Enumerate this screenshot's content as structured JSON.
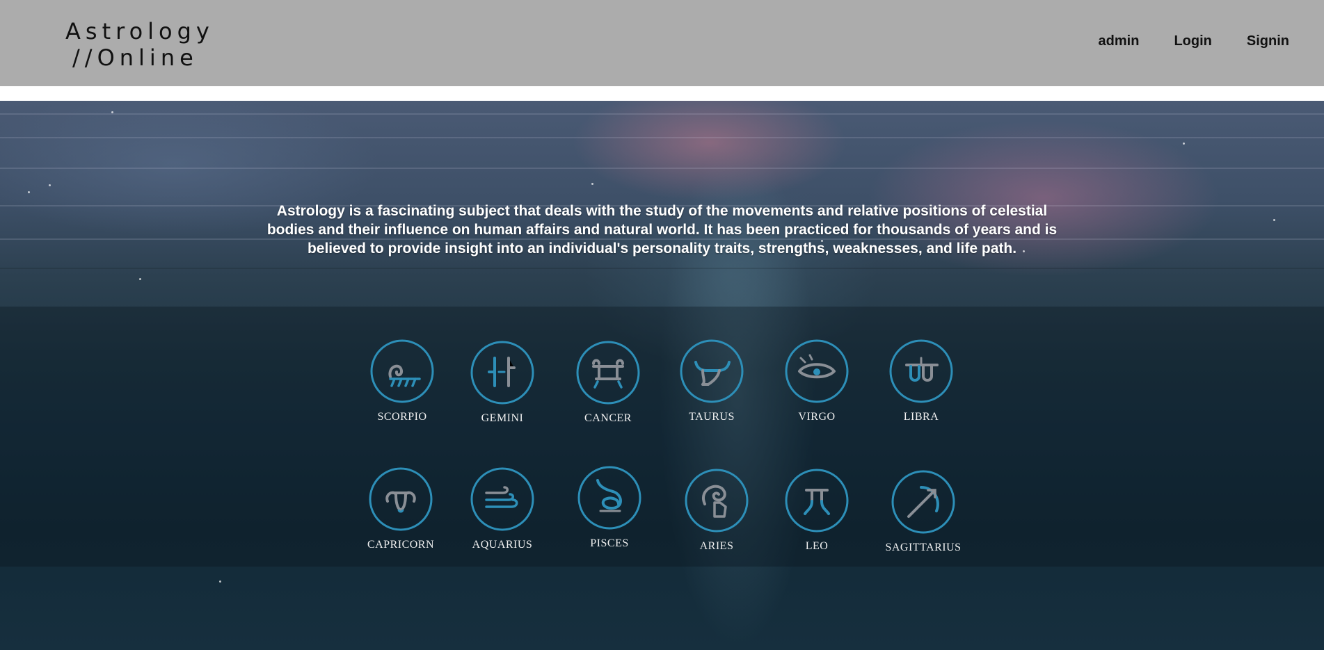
{
  "header": {
    "logo_line1": "Astrology",
    "logo_line2": "//Online",
    "nav": [
      "admin",
      "Login",
      "Signin"
    ]
  },
  "hero": {
    "intro": "Astrology is a fascinating subject that deals with the study of the movements and relative positions of celestial bodies and their influence on human affairs and natural world. It has been practiced for thousands of years and is believed to provide insight into an individual's personality traits, strengths, weaknesses, and life path."
  },
  "zodiac": {
    "row1": [
      "SCORPIO",
      "GEMINI",
      "CANCER",
      "TAURUS",
      "VIRGO",
      "LIBRA"
    ],
    "row2": [
      "CAPRICORN",
      "AQUARIUS",
      "PISCES",
      "ARIES",
      "LEO",
      "SAGITTARIUS"
    ]
  },
  "colors": {
    "header_bg": "#acacac",
    "icon_ring": "#2d8fb8",
    "icon_glyph": "#8a8f96"
  }
}
